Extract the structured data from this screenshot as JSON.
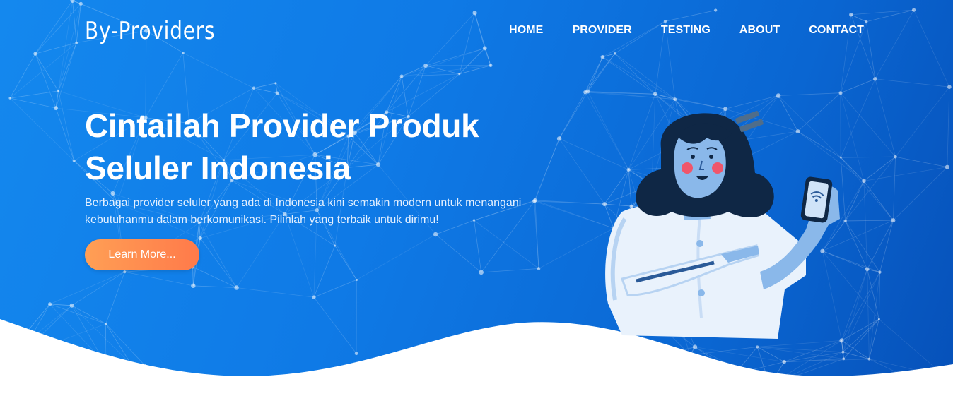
{
  "header": {
    "brand": "By-Providers",
    "nav": [
      {
        "label": "HOME"
      },
      {
        "label": "PROVIDER"
      },
      {
        "label": "TESTING"
      },
      {
        "label": "ABOUT"
      },
      {
        "label": "CONTACT"
      }
    ]
  },
  "hero": {
    "title_line1": "Cintailah Provider Produk",
    "title_line2": "Seluler Indonesia",
    "description": "Berbagai provider seluler yang ada di Indonesia kini semakin modern untuk menangani kebutuhanmu dalam berkomunikasi. Pilihlah yang terbaik untuk dirimu!",
    "cta_label": "Learn More..."
  },
  "colors": {
    "hero_start": "#1488ee",
    "hero_end": "#0650b8",
    "cta_start": "#ff9f55",
    "cta_end": "#ff7a4a",
    "illustration_skin": "#8ab8ea",
    "illustration_hair": "#0f2745",
    "illustration_cheek": "#f0566b"
  },
  "icons": {
    "background": "network-mesh-icon",
    "illustration": "woman-with-phone-icon",
    "phone_signal": "wifi-signal-icon"
  }
}
